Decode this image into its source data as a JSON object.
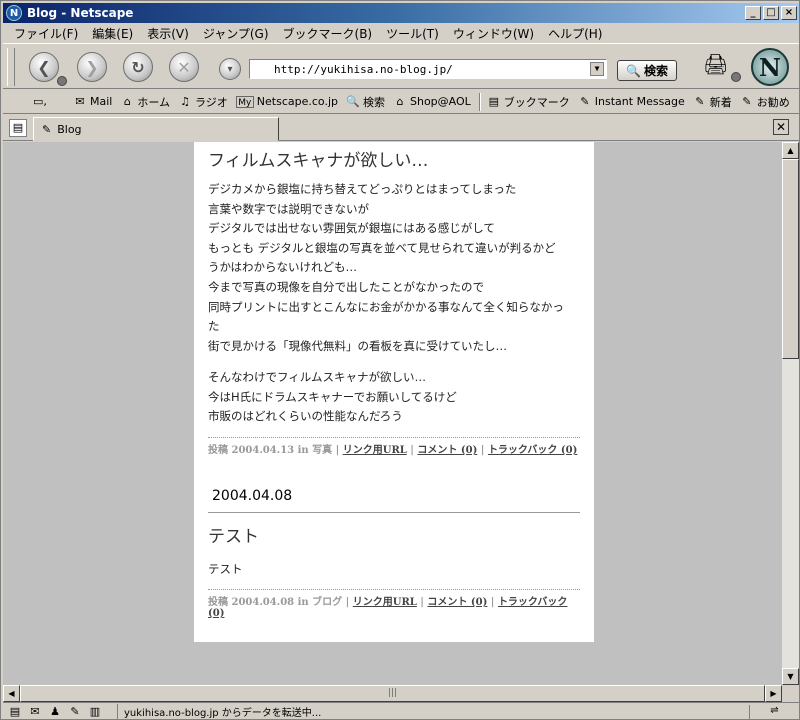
{
  "window": {
    "title": "Blog - Netscape"
  },
  "menu": [
    "ファイル(F)",
    "編集(E)",
    "表示(V)",
    "ジャンプ(G)",
    "ブックマーク(B)",
    "ツール(T)",
    "ウィンドウ(W)",
    "ヘルプ(H)"
  ],
  "nav": {
    "url": "http://yukihisa.no-blog.jp/",
    "search_label": "検索"
  },
  "personal_toolbar": [
    {
      "label": "Mail",
      "icon": "mail-icon"
    },
    {
      "label": "ホーム",
      "icon": "home-icon"
    },
    {
      "label": "ラジオ",
      "icon": "radio-icon"
    },
    {
      "label": "Netscape.co.jp",
      "icon": "my-netscape-icon"
    },
    {
      "label": "検索",
      "icon": "search-icon"
    },
    {
      "label": "Shop@AOL",
      "icon": "shop-icon"
    },
    {
      "label": "ブックマーク",
      "icon": "bookmarks-icon"
    },
    {
      "label": "Instant Message",
      "icon": "bookmark-link-icon"
    },
    {
      "label": "新着",
      "icon": "bookmark-link-icon"
    },
    {
      "label": "お勧め",
      "icon": "bookmark-link-icon"
    }
  ],
  "tab": {
    "label": "Blog"
  },
  "entries": [
    {
      "title": "フィルムスキャナが欲しい…",
      "paragraphs": [
        [
          "デジカメから銀塩に持ち替えてどっぷりとはまってしまった",
          "言葉や数字では説明できないが",
          "デジタルでは出せない雰囲気が銀塩にはある感じがして",
          "もっとも デジタルと銀塩の写真を並べて見せられて違いが判るかど",
          "うかはわからないけれども…",
          "今まで写真の現像を自分で出したことがなかったので",
          "同時プリントに出すとこんなにお金がかかる事なんて全く知らなかっ",
          "た",
          "街で見かける「現像代無料」の看板を真に受けていたし…"
        ],
        [
          "そんなわけでフィルムスキャナが欲しい…",
          "今はH氏にドラムスキャナーでお願いしてるけど",
          "市販のはどれくらいの性能なんだろう"
        ]
      ],
      "meta": {
        "posted": "投稿 2004.04.13 in 写真",
        "permalink": "リンク用URL",
        "comments": "コメント (0)",
        "trackback": "トラックバック (0)"
      }
    },
    {
      "date": "2004.04.08",
      "title": "テスト",
      "paragraphs": [
        [
          "テスト"
        ]
      ],
      "meta": {
        "posted": "投稿 2004.04.08 in ブログ",
        "permalink": "リンク用URL",
        "comments": "コメント (0)",
        "trackback": "トラックバック (0)"
      }
    }
  ],
  "status": {
    "text": "yukihisa.no-blog.jp からデータを転送中..."
  }
}
